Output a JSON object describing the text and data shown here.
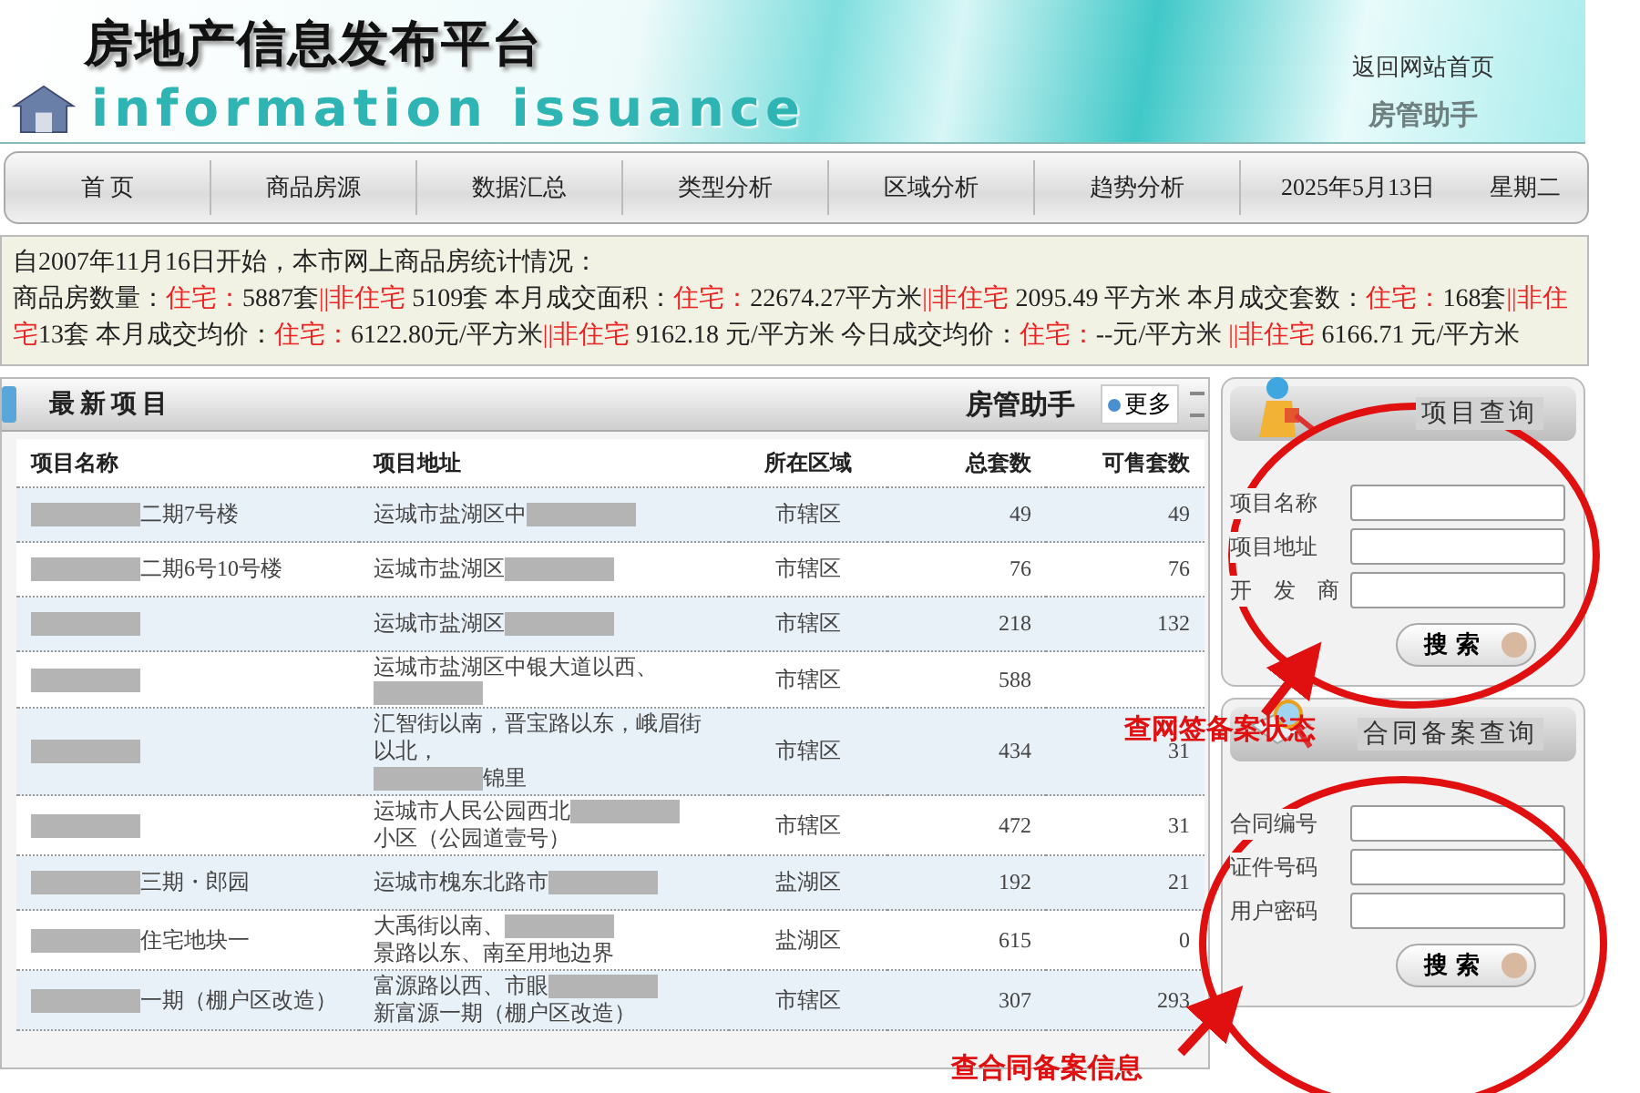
{
  "header": {
    "title": "房地产信息发布平台",
    "subtitle": "information issuance",
    "home_link": "返回网站首页",
    "assistant": "房管助手"
  },
  "nav": {
    "items": [
      {
        "label": "首 页"
      },
      {
        "label": "商品房源"
      },
      {
        "label": "数据汇总"
      },
      {
        "label": "类型分析"
      },
      {
        "label": "区域分析"
      },
      {
        "label": "趋势分析"
      }
    ],
    "date": "2025年5月13日",
    "weekday": "星期二"
  },
  "stats": {
    "intro": "自2007年11月16日开始，本市网上商品房统计情况：",
    "segments": [
      {
        "text": "商品房数量：",
        "highlight": false
      },
      {
        "text": "住宅：",
        "highlight": true
      },
      {
        "text": "5887套",
        "highlight": false
      },
      {
        "text": "||",
        "highlight": true
      },
      {
        "text": "非住宅",
        "highlight": true
      },
      {
        "text": " 5109套  本月成交面积：",
        "highlight": false
      },
      {
        "text": "住宅：",
        "highlight": true
      },
      {
        "text": "22674.27平方米",
        "highlight": false
      },
      {
        "text": "||",
        "highlight": true
      },
      {
        "text": "非住宅",
        "highlight": true
      },
      {
        "text": " 2095.49  平方米     本月成交套数：",
        "highlight": false
      },
      {
        "text": "住宅：",
        "highlight": true
      },
      {
        "text": "168套",
        "highlight": false
      },
      {
        "text": "||",
        "highlight": true
      },
      {
        "text": "非住宅",
        "highlight": true
      },
      {
        "text": "13套      本月成交均价：",
        "highlight": false
      },
      {
        "text": "住宅：",
        "highlight": true
      },
      {
        "text": "6122.80元/平方米",
        "highlight": false
      },
      {
        "text": "||",
        "highlight": true
      },
      {
        "text": "非住宅",
        "highlight": true
      },
      {
        "text": " 9162.18 元/平方米  今日成交均价：",
        "highlight": false
      },
      {
        "text": "住宅：",
        "highlight": true
      },
      {
        "text": "--元/平方米 ",
        "highlight": false
      },
      {
        "text": "||",
        "highlight": true
      },
      {
        "text": "非住宅",
        "highlight": true
      },
      {
        "text": " 6166.71 元/平方米",
        "highlight": false
      }
    ]
  },
  "projects": {
    "title": "最新项目",
    "assistant": "房管助手",
    "more": "更多",
    "columns": [
      "项目名称",
      "项目地址",
      "所在区域",
      "总套数",
      "可售套数"
    ],
    "rows": [
      {
        "name": [
          {
            "kind": "redacted"
          },
          {
            "kind": "text",
            "text": "二期7号楼"
          }
        ],
        "address": [
          {
            "kind": "text",
            "text": "运城市盐湖区中"
          },
          {
            "kind": "redacted"
          }
        ],
        "region": "市辖区",
        "total": "49",
        "available": "49"
      },
      {
        "name": [
          {
            "kind": "redacted"
          },
          {
            "kind": "text",
            "text": "二期6号10号楼"
          }
        ],
        "address": [
          {
            "kind": "text",
            "text": "运城市盐湖区"
          },
          {
            "kind": "redacted"
          }
        ],
        "region": "市辖区",
        "total": "76",
        "available": "76"
      },
      {
        "name": [
          {
            "kind": "redacted"
          }
        ],
        "address": [
          {
            "kind": "text",
            "text": "运城市盐湖区"
          },
          {
            "kind": "redacted"
          }
        ],
        "region": "市辖区",
        "total": "218",
        "available": "132"
      },
      {
        "name": [
          {
            "kind": "redacted"
          }
        ],
        "address": [
          {
            "kind": "text",
            "text": "运城市盐湖区中银大道以西、"
          },
          {
            "kind": "redacted"
          }
        ],
        "region": "市辖区",
        "total": "588"
      },
      {
        "name": [
          {
            "kind": "redacted"
          }
        ],
        "address": [
          {
            "kind": "text",
            "text": "汇智街以南，晋宝路以东，峨眉街以北，"
          },
          {
            "kind": "redacted"
          },
          {
            "kind": "text",
            "text": "锦里"
          }
        ],
        "region": "市辖区",
        "total": "434",
        "available": "31"
      },
      {
        "name": [
          {
            "kind": "redacted"
          }
        ],
        "address": [
          {
            "kind": "text",
            "text": "运城市人民公园西北"
          },
          {
            "kind": "redacted"
          },
          {
            "kind": "text",
            "text": "小区（公园道壹号）"
          }
        ],
        "region": "市辖区",
        "total": "472",
        "available": "31"
      },
      {
        "name": [
          {
            "kind": "redacted"
          },
          {
            "kind": "text",
            "text": "三期・郎园"
          }
        ],
        "address": [
          {
            "kind": "text",
            "text": "运城市槐东北路市"
          },
          {
            "kind": "redacted"
          }
        ],
        "region": "盐湖区",
        "total": "192",
        "available": "21"
      },
      {
        "name": [
          {
            "kind": "redacted"
          },
          {
            "kind": "text",
            "text": "住宅地块一"
          }
        ],
        "address": [
          {
            "kind": "text",
            "text": "大禹街以南、"
          },
          {
            "kind": "redacted"
          },
          {
            "kind": "text",
            "text": "景路以东、南至用地边界"
          }
        ],
        "region": "盐湖区",
        "total": "615",
        "available": "0"
      },
      {
        "name": [
          {
            "kind": "redacted"
          },
          {
            "kind": "text",
            "text": "一期（棚户区改造）"
          }
        ],
        "address": [
          {
            "kind": "text",
            "text": "富源路以西、市眼"
          },
          {
            "kind": "redacted"
          },
          {
            "kind": "text",
            "text": "新富源一期（棚户区改造）"
          }
        ],
        "region": "市辖区",
        "total": "307",
        "available": "293"
      }
    ]
  },
  "search_panels": [
    {
      "kind": "project",
      "title": "项目查询",
      "fields": [
        {
          "label": "项目名称"
        },
        {
          "label": "项目地址"
        },
        {
          "label": "开　发　商"
        }
      ],
      "button": "搜 索"
    },
    {
      "kind": "contract",
      "title": "合同备案查询",
      "fields": [
        {
          "label": "合同编号"
        },
        {
          "label": "证件号码"
        },
        {
          "label": "用户密码"
        }
      ],
      "button": "搜 索"
    }
  ],
  "annotations": [
    {
      "text": "查网签备案状态"
    },
    {
      "text": "查合同备案信息"
    }
  ]
}
